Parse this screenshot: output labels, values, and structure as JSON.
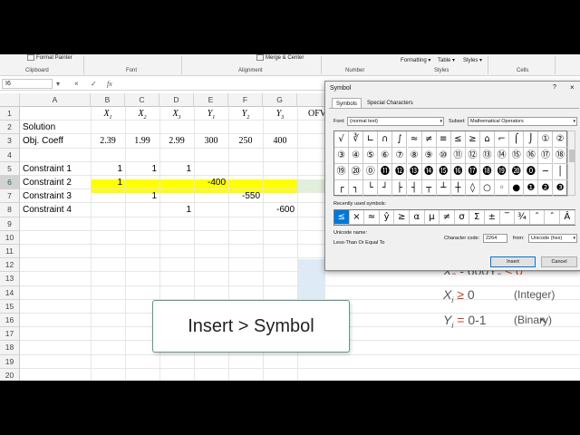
{
  "ribbon": {
    "format_painter": "Format Painter",
    "merge_center": "Merge & Center",
    "formatting": "Formatting",
    "table": "Table",
    "styles": "Styles",
    "groups": [
      "Clipboard",
      "Font",
      "Alignment",
      "Number",
      "Styles",
      "Cells"
    ]
  },
  "formula_bar": {
    "name_box": "I6",
    "cancel": "×",
    "enter": "✓",
    "fx": "fx"
  },
  "grid": {
    "columns": [
      "A",
      "B",
      "C",
      "D",
      "E",
      "F",
      "G"
    ],
    "rows": [
      "1",
      "2",
      "3",
      "4",
      "5",
      "6",
      "7",
      "8",
      "9",
      "10",
      "11",
      "12",
      "13",
      "14",
      "15",
      "16",
      "17",
      "18",
      "19",
      "20"
    ],
    "header_row": {
      "B": "X",
      "B_sub": "1",
      "C": "X",
      "C_sub": "2",
      "D": "X",
      "D_sub": "3",
      "E": "Y",
      "E_sub": "1",
      "F": "Y",
      "F_sub": "2",
      "G": "Y",
      "G_sub": "3",
      "H": "OFV"
    },
    "solution_label": "Solution",
    "obj_coeff": {
      "label": "Obj. Coeff",
      "B": "2.39",
      "C": "1.99",
      "D": "2.99",
      "E": "300",
      "F": "250",
      "G": "400"
    },
    "constraint1": {
      "label": "Constraint 1",
      "B": "1",
      "C": "1",
      "D": "1"
    },
    "constraint2": {
      "label": "Constraint 2",
      "B": "1",
      "E": "-400"
    },
    "constraint3": {
      "label": "Constraint 3",
      "C": "1",
      "F": "-550"
    },
    "constraint4": {
      "label": "Constraint 4",
      "D": "1",
      "G": "-600"
    }
  },
  "callout": "Insert > Symbol",
  "math": {
    "line1_partial": "X",
    "line1_sub": "3",
    "line1_rest": " - 600Y",
    "line1_sub2": "3",
    "line1_end": " ≤ 0",
    "line2_var": "X",
    "line2_sub": "i",
    "line2_op": " ≥ ",
    "line2_val": "0",
    "line2_tag": "(Integer)",
    "line3_var": "Y",
    "line3_sub": "i",
    "line3_op": " = ",
    "line3_val": "0-1",
    "line3_tag": "(Binary)"
  },
  "dialog": {
    "title": "Symbol",
    "help": "?",
    "close": "×",
    "tabs": [
      "Symbols",
      "Special Characters"
    ],
    "font_label": "Font:",
    "font_value": "(normal text)",
    "subset_label": "Subset:",
    "subset_value": "Mathematical Operators",
    "symbols_row1": [
      "√",
      "∛",
      "∟",
      "∩",
      "∫",
      "≈",
      "≠",
      "≡",
      "≤",
      "≥",
      "⌂",
      "⌐",
      "⌠",
      "⌡",
      "①",
      "②"
    ],
    "symbols_row2": [
      "③",
      "④",
      "⑤",
      "⑥",
      "⑦",
      "⑧",
      "⑨",
      "⑩",
      "⑪",
      "⑫",
      "⑬",
      "⑭",
      "⑮",
      "⑯",
      "⑰",
      "⑱"
    ],
    "symbols_row3": [
      "⑲",
      "⑳",
      "⓪",
      "⓫",
      "⓬",
      "⓭",
      "⓮",
      "⓯",
      "⓰",
      "⓱",
      "⓲",
      "⓳",
      "⓴",
      "⓿",
      "─",
      "│"
    ],
    "symbols_row4": [
      "┌",
      "┐",
      "└",
      "┘",
      "├",
      "┤",
      "┬",
      "┴",
      "┼",
      "◊",
      "○",
      "◦",
      "●",
      "❶",
      "❷",
      "❸",
      "❹"
    ],
    "recent_label": "Recently used symbols:",
    "recent": [
      "≤",
      "×",
      "≈",
      "ŷ",
      "≥",
      "α",
      "μ",
      "≠",
      "σ",
      "Σ",
      "±",
      "‾",
      "¾",
      "ˆ",
      "ˆ",
      "Â"
    ],
    "unicode_name_label": "Unicode name:",
    "unicode_name": "Less-Than Or Equal To",
    "char_code_label": "Character code:",
    "char_code": "2264",
    "from_label": "from:",
    "from_value": "Unicode (hex)",
    "insert": "Insert",
    "cancel": "Cancel"
  }
}
